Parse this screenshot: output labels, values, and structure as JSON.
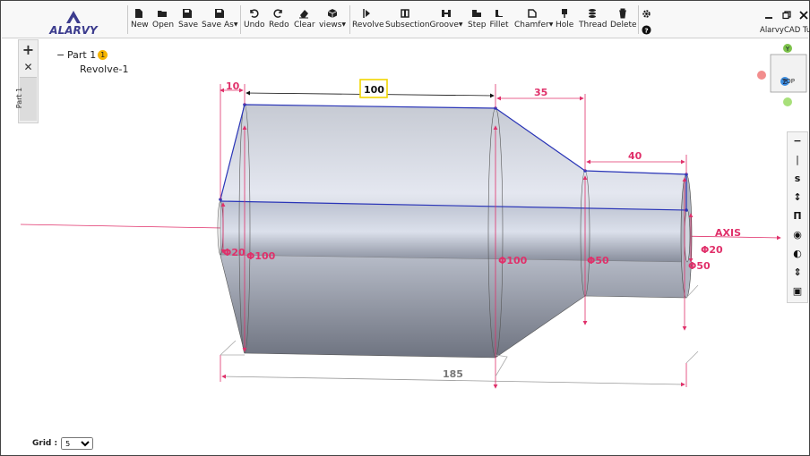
{
  "app": {
    "logo_text": "ALARVY",
    "title": "AlarvyCAD Tur"
  },
  "toolbar": {
    "file": [
      {
        "name": "new-button",
        "label": "New",
        "icon": "file-icon"
      },
      {
        "name": "open-button",
        "label": "Open",
        "icon": "folder-icon"
      },
      {
        "name": "save-button",
        "label": "Save",
        "icon": "floppy-icon"
      },
      {
        "name": "save-as-button",
        "label": "Save As",
        "icon": "floppy-pen-icon",
        "dropdown": true
      }
    ],
    "edit": [
      {
        "name": "undo-button",
        "label": "Undo",
        "icon": "undo-icon"
      },
      {
        "name": "redo-button",
        "label": "Redo",
        "icon": "redo-icon"
      },
      {
        "name": "clear-button",
        "label": "Clear",
        "icon": "eraser-icon"
      },
      {
        "name": "views-button",
        "label": "views",
        "icon": "cube-icon",
        "dropdown": true
      }
    ],
    "features": [
      {
        "name": "revolve-button",
        "label": "Revolve",
        "icon": "revolve-icon"
      },
      {
        "name": "subsection-button",
        "label": "Subsection",
        "icon": "subsection-icon"
      },
      {
        "name": "groove-button",
        "label": "Groove",
        "icon": "groove-icon",
        "dropdown": true
      },
      {
        "name": "step-button",
        "label": "Step",
        "icon": "step-icon"
      },
      {
        "name": "fillet-button",
        "label": "Fillet",
        "icon": "fillet-icon"
      },
      {
        "name": "chamfer-button",
        "label": "Chamfer",
        "icon": "chamfer-icon",
        "dropdown": true
      },
      {
        "name": "hole-button",
        "label": "Hole",
        "icon": "hole-icon"
      },
      {
        "name": "thread-button",
        "label": "Thread",
        "icon": "thread-icon"
      },
      {
        "name": "delete-button",
        "label": "Delete",
        "icon": "trash-icon"
      }
    ]
  },
  "tree": {
    "part": "Part 1",
    "part_badge": "1",
    "feature": "Revolve-1"
  },
  "sidebar": {
    "tab_label": "Part 1"
  },
  "viewcube": {
    "face_label": "TOP",
    "axis_y": "Y",
    "axis_z": "Z"
  },
  "right_panel": [
    "minus-icon",
    "line-icon",
    "s-icon",
    "double-arrow-icon",
    "pi-icon",
    "eye-icon",
    "contrast-icon",
    "up-down-icon",
    "sketch-icon"
  ],
  "right_panel_glyphs": [
    "−",
    "|",
    "s",
    "↕",
    "Π",
    "◉",
    "◐",
    "⇕",
    "▣"
  ],
  "dimensions": {
    "d1": "10",
    "d2": "100",
    "d3": "35",
    "d4": "40",
    "d5": "185",
    "axis": "AXIS",
    "dia_bore": "Φ20",
    "dia_main": "Φ100",
    "dia_mid": "Φ100",
    "dia_step": "Φ50",
    "dia_bore_end": "Φ20",
    "dia_end": "Φ50"
  },
  "colors": {
    "dimension": "#e0306a",
    "edge": "#2a35b8",
    "highlight": "#f2d600",
    "body": "#b3b9c6"
  },
  "grid": {
    "label": "Grid :",
    "value": "5",
    "options": [
      "5"
    ]
  }
}
